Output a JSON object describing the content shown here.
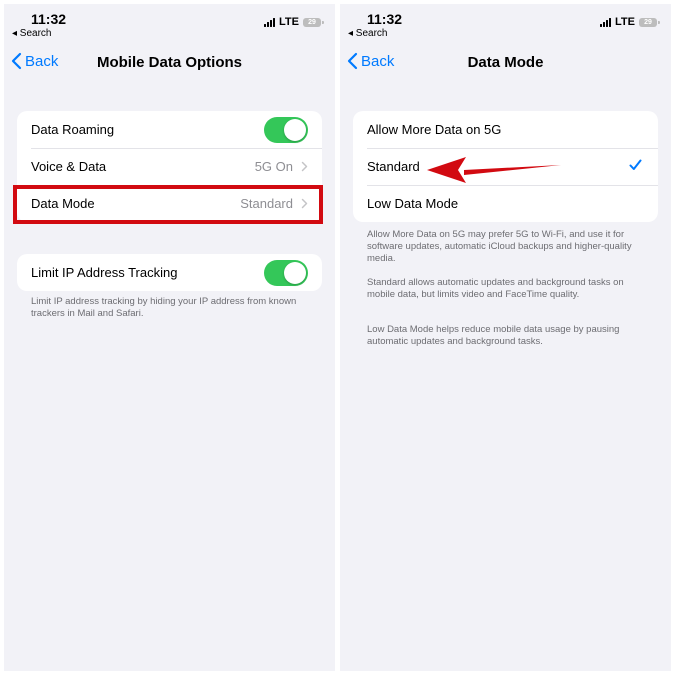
{
  "left": {
    "status": {
      "time": "11:32",
      "back_app": "◂ Search",
      "network": "LTE",
      "battery": "29"
    },
    "nav": {
      "back_label": "Back",
      "title": "Mobile Data Options"
    },
    "group1": [
      {
        "label": "Data Roaming",
        "toggle_on": true
      },
      {
        "label": "Voice & Data",
        "value": "5G On"
      },
      {
        "label": "Data Mode",
        "value": "Standard"
      }
    ],
    "group2": {
      "label": "Limit IP Address Tracking",
      "toggle_on": true
    },
    "footer": "Limit IP address tracking by hiding your IP address from known trackers in Mail and Safari."
  },
  "right": {
    "status": {
      "time": "11:32",
      "back_app": "◂ Search",
      "network": "LTE",
      "battery": "29"
    },
    "nav": {
      "back_label": "Back",
      "title": "Data Mode"
    },
    "options": [
      {
        "label": "Allow More Data on 5G",
        "selected": false
      },
      {
        "label": "Standard",
        "selected": true
      },
      {
        "label": "Low Data Mode",
        "selected": false
      }
    ],
    "footers": [
      "Allow More Data on 5G may prefer 5G to Wi-Fi, and use it for software updates, automatic iCloud backups and higher-quality media.",
      "Standard allows automatic updates and background tasks on mobile data, but limits video and FaceTime quality.",
      "Low Data Mode helps reduce mobile data usage by pausing automatic updates and background tasks."
    ]
  },
  "colors": {
    "accent": "#007aff",
    "toggle_on": "#34c759",
    "highlight": "#d20a11"
  }
}
